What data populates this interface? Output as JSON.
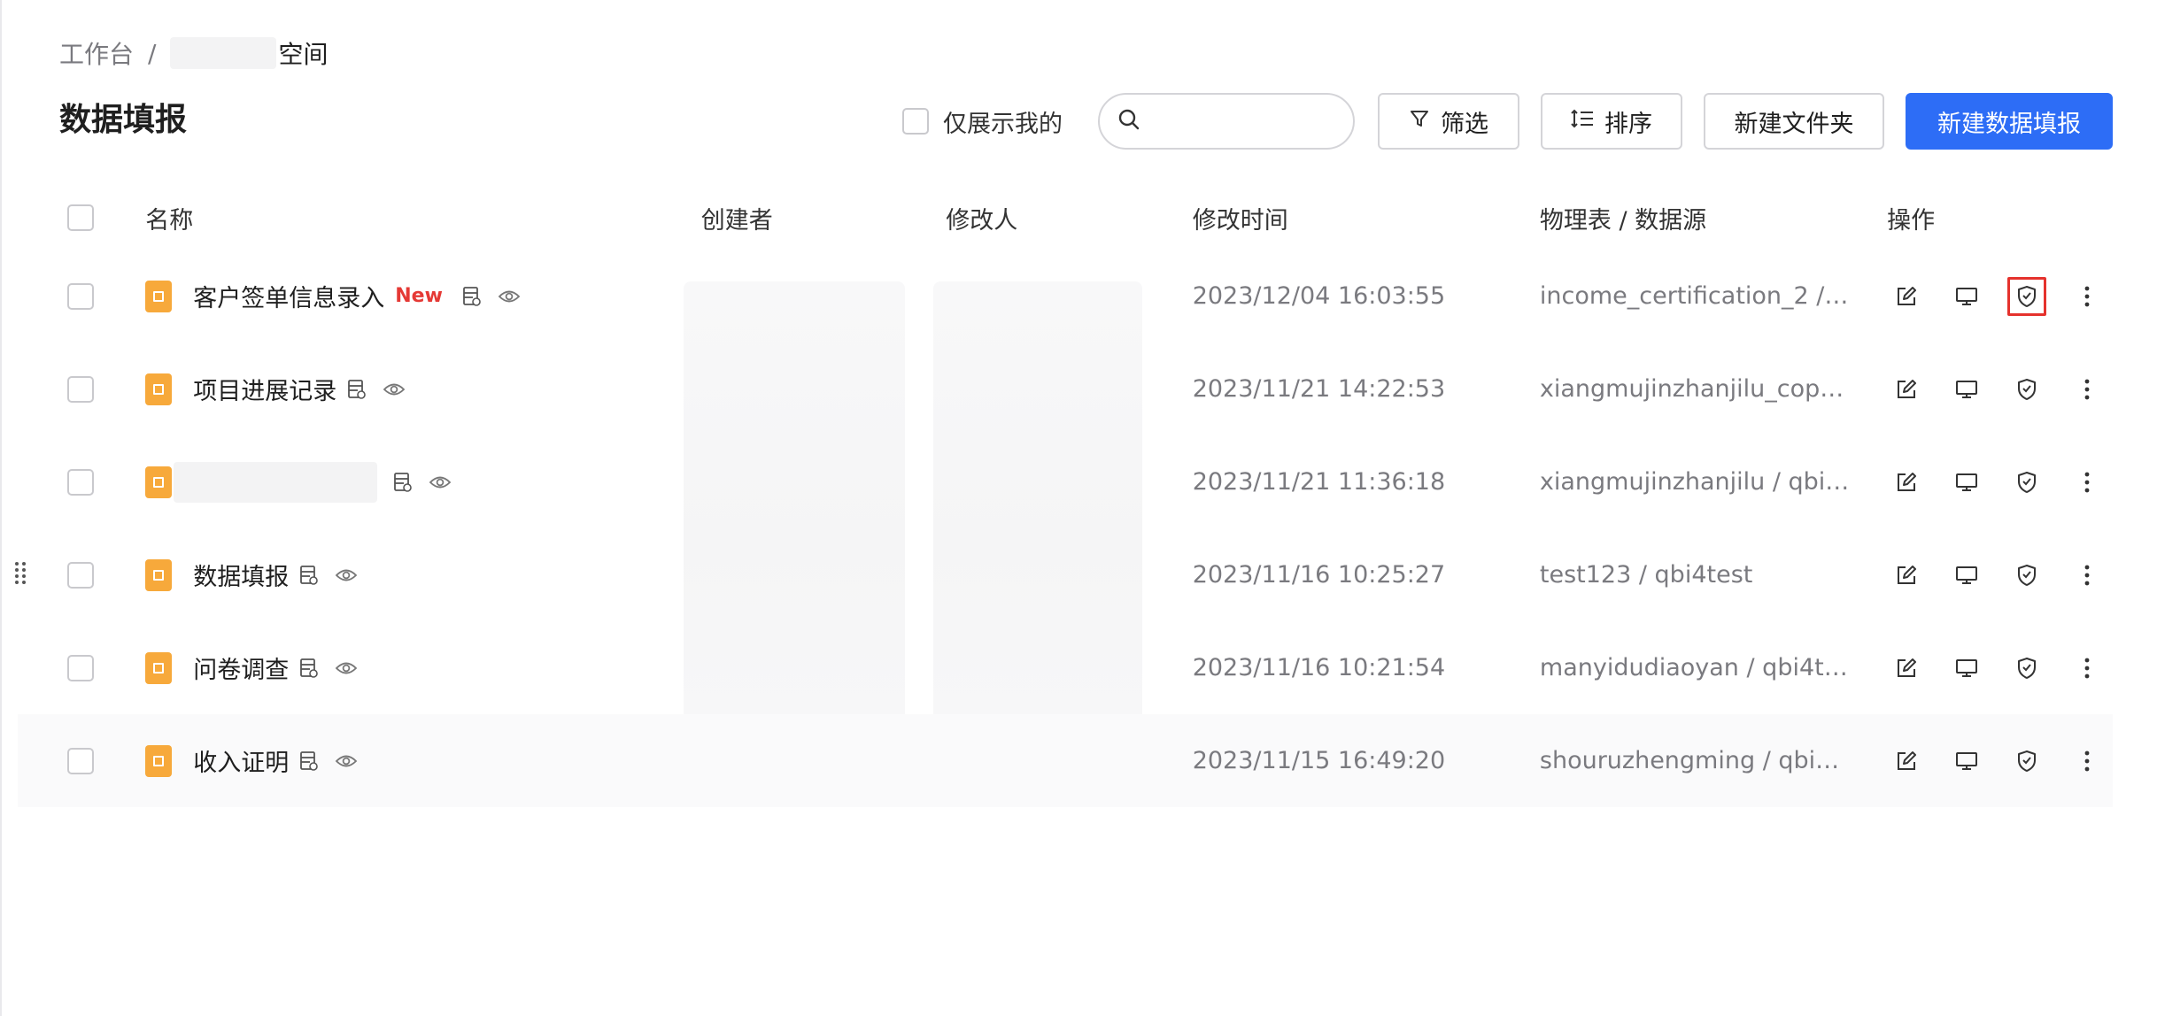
{
  "breadcrumb": {
    "root": "工作台",
    "separator": "/",
    "current": "空间"
  },
  "page": {
    "title": "数据填报"
  },
  "toolbar": {
    "only_mine_label": "仅展示我的",
    "search_placeholder": "",
    "filter_label": "筛选",
    "sort_label": "排序",
    "new_folder_label": "新建文件夹",
    "new_form_label": "新建数据填报",
    "primary_color": "#2d6df6"
  },
  "table": {
    "headers": {
      "name": "名称",
      "creator": "创建者",
      "modifier": "修改人",
      "modified_time": "修改时间",
      "source": "物理表 / 数据源",
      "ops": "操作"
    },
    "rows": [
      {
        "name": "客户签单信息录入",
        "tag": "New",
        "modified_time": "2023/12/04 16:03:55",
        "source": "income_certification_2 / ..."
      },
      {
        "name": "项目进展记录",
        "tag": "",
        "modified_time": "2023/11/21 14:22:53",
        "source": "xiangmujinzhanjilu_copy ..."
      },
      {
        "name": "",
        "tag": "",
        "modified_time": "2023/11/21 11:36:18",
        "source": "xiangmujinzhanjilu / qbi4t..."
      },
      {
        "name": "数据填报",
        "tag": "",
        "modified_time": "2023/11/16 10:25:27",
        "source": "test123 / qbi4test"
      },
      {
        "name": "问卷调查",
        "tag": "",
        "modified_time": "2023/11/16 10:21:54",
        "source": "manyidudiaoyan / qbi4test"
      },
      {
        "name": "收入证明",
        "tag": "",
        "modified_time": "2023/11/15 16:49:20",
        "source": "shouruzhengming / qbi4t..."
      }
    ],
    "row_icons": [
      "table-preview-icon",
      "eye-icon"
    ],
    "op_icons": [
      "edit-icon",
      "monitor-icon",
      "shield-check-icon",
      "more-vertical-icon"
    ],
    "file_icon_color": "#f7a93b",
    "new_tag_color": "#e53935",
    "highlight_color": "#e5322d"
  }
}
